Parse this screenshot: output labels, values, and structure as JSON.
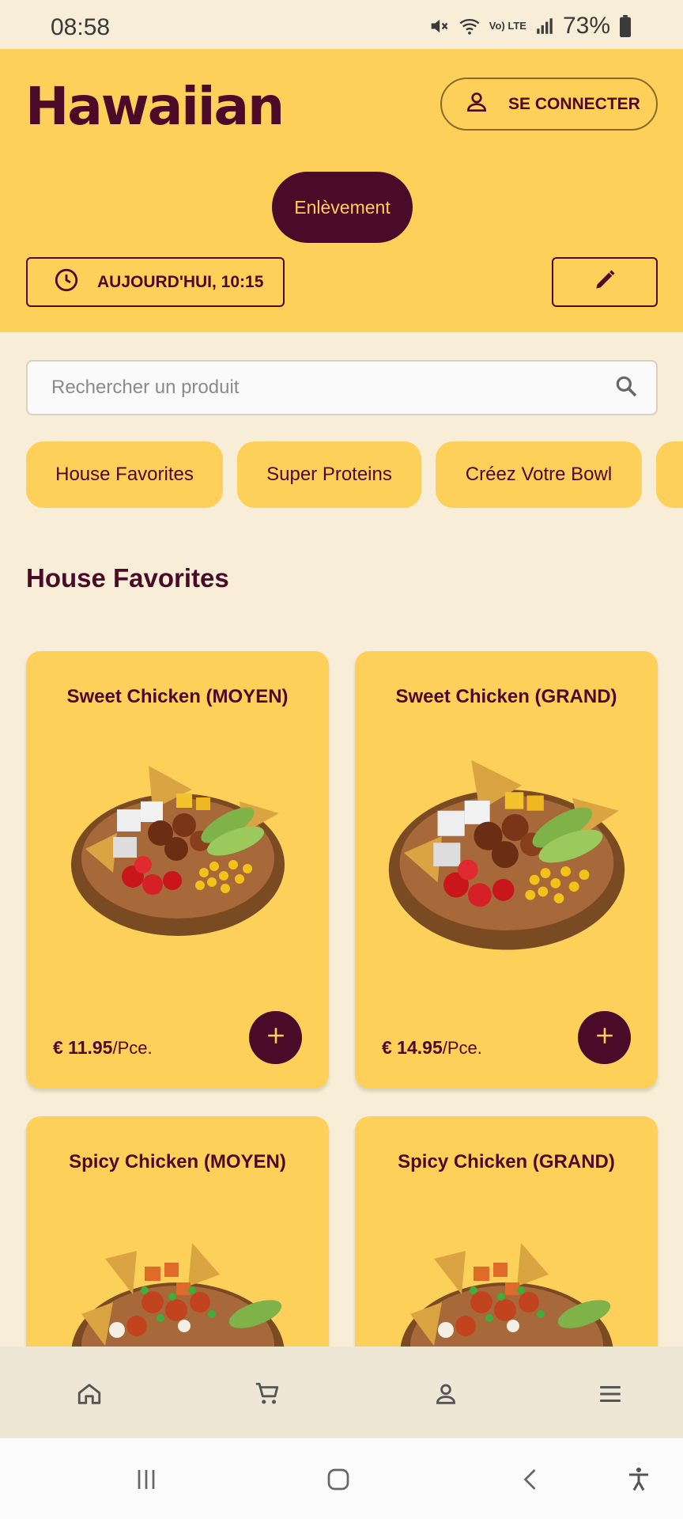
{
  "status_bar": {
    "time": "08:58",
    "battery": "73%",
    "volte": "Vo) LTE",
    "icons": [
      "mute-icon",
      "wifi-icon",
      "signal-icon",
      "battery-icon"
    ]
  },
  "header": {
    "logo": "Hawaiian",
    "login_label": "SE CONNECTER",
    "mode_label": "Enlèvement",
    "time_label": "AUJOURD'HUI, 10:15"
  },
  "search": {
    "placeholder": "Rechercher un produit"
  },
  "categories": [
    {
      "label": "House Favorites"
    },
    {
      "label": "Super Proteins"
    },
    {
      "label": "Créez Votre Bowl"
    }
  ],
  "section": {
    "title": "House Favorites"
  },
  "products": [
    {
      "name": "Sweet Chicken (MOYEN)",
      "price": "€ 11.95",
      "unit": "/Pce."
    },
    {
      "name": "Sweet Chicken (GRAND)",
      "price": "€ 14.95",
      "unit": "/Pce."
    },
    {
      "name": "Spicy Chicken (MOYEN)",
      "price": "",
      "unit": ""
    },
    {
      "name": "Spicy Chicken (GRAND)",
      "price": "",
      "unit": ""
    }
  ],
  "colors": {
    "brand_yellow": "#FDD05A",
    "brand_maroon": "#4A0A28",
    "background": "#F8EDD6"
  },
  "bottom_nav": [
    "home-icon",
    "cart-icon",
    "account-icon",
    "menu-icon"
  ],
  "system_nav": [
    "recents-icon",
    "home-button-icon",
    "back-icon",
    "accessibility-icon"
  ]
}
